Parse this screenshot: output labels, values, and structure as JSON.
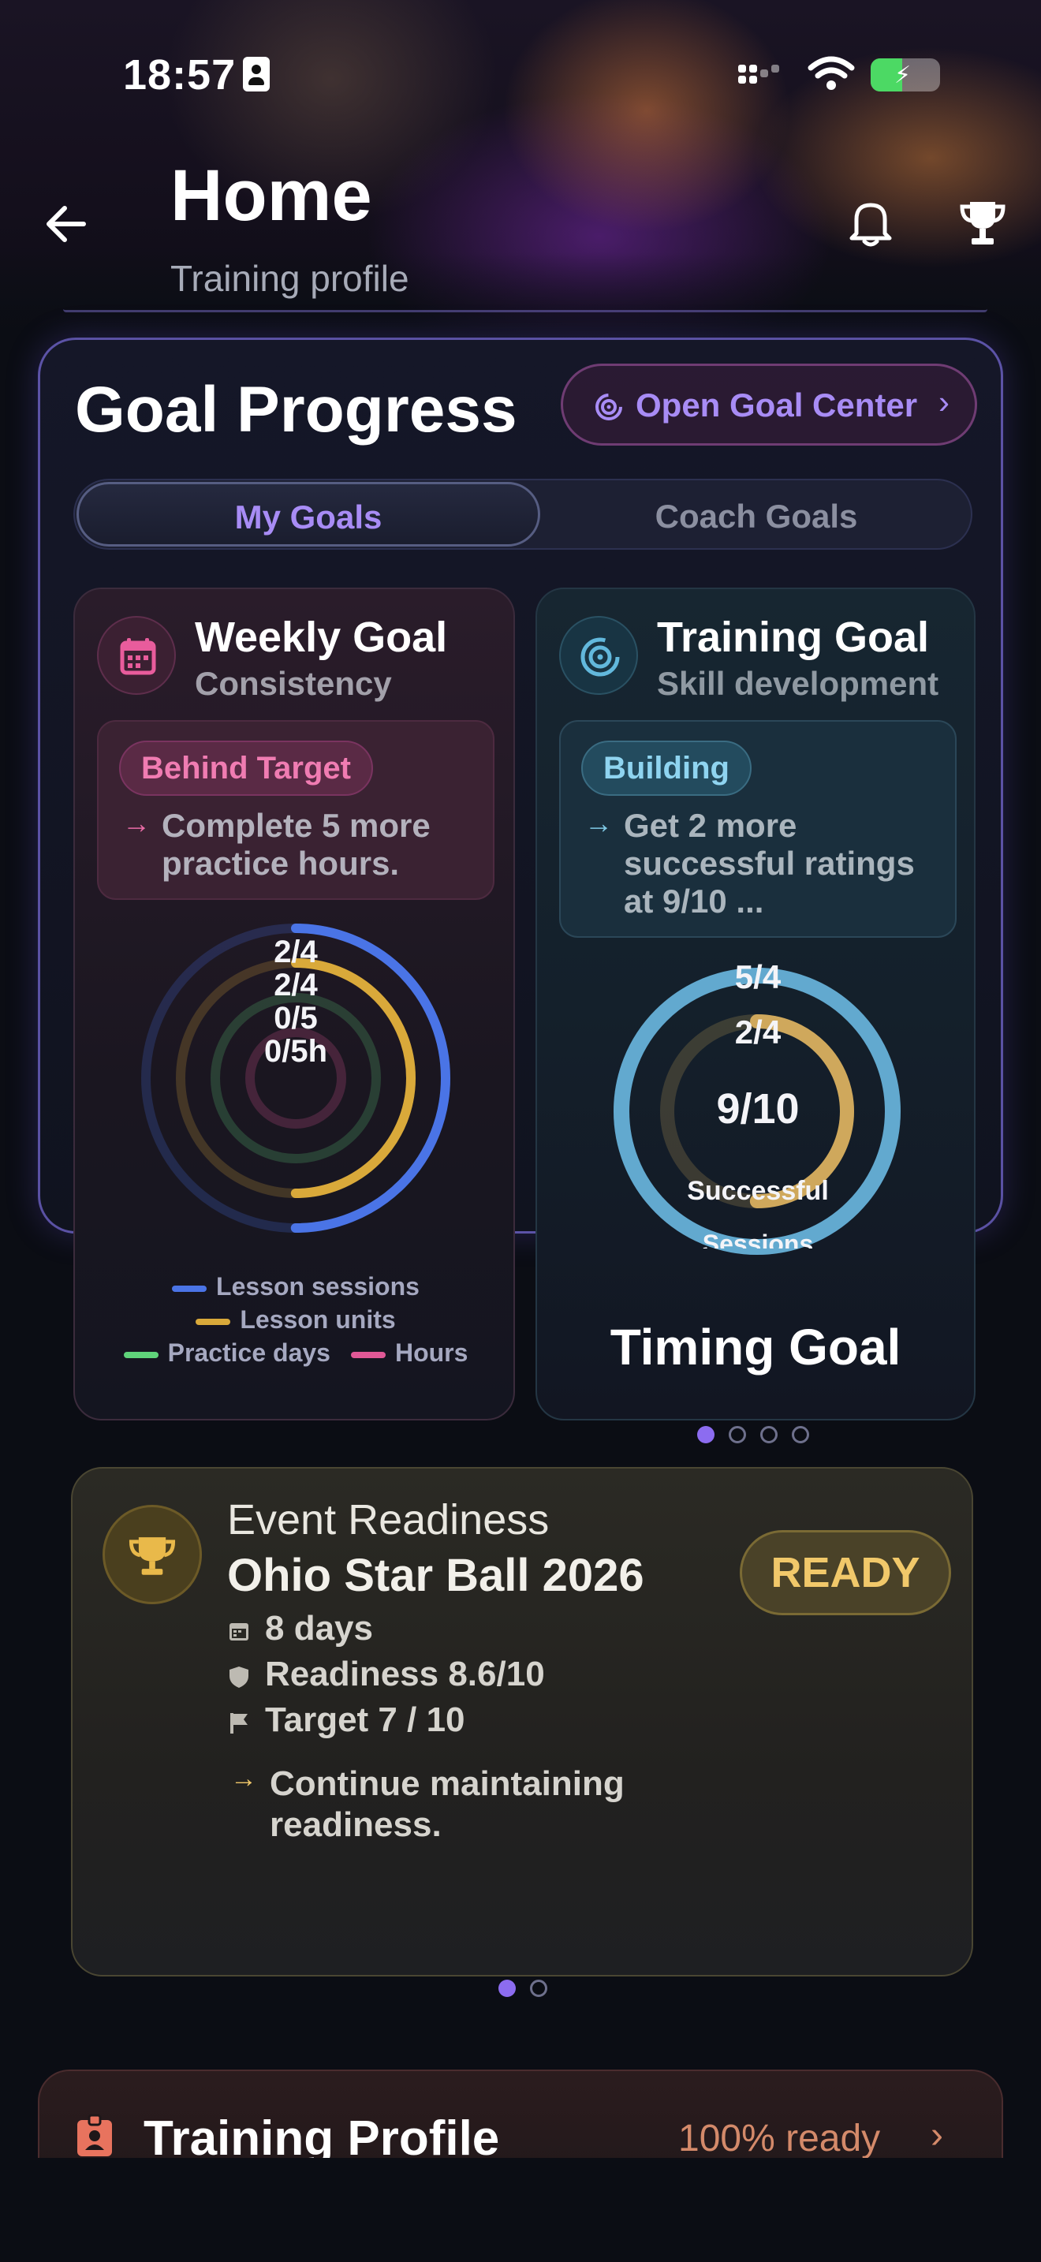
{
  "status_bar": {
    "time": "18:57"
  },
  "header": {
    "title": "Home",
    "subtitle": "Training profile"
  },
  "goal_progress": {
    "title": "Goal Progress",
    "open_button": "Open Goal Center",
    "tabs": [
      {
        "label": "My Goals",
        "selected": true
      },
      {
        "label": "Coach Goals",
        "selected": false
      }
    ],
    "weekly": {
      "title": "Weekly Goal",
      "subtitle": "Consistency",
      "status": "Behind Target",
      "message": "Complete 5 more practice hours.",
      "ring_labels": [
        "2/4",
        "2/4",
        "0/5",
        "0/5h"
      ],
      "rings": [
        {
          "name": "Lesson sessions",
          "color": "#4a74e6",
          "fraction": 0.5
        },
        {
          "name": "Lesson units",
          "color": "#d9a93a",
          "fraction": 0.5
        },
        {
          "name": "Practice days",
          "color": "#5fd37a",
          "fraction": 0
        },
        {
          "name": "Hours",
          "color": "#e05896",
          "fraction": 0
        }
      ],
      "legend": [
        "Lesson sessions",
        "Lesson units",
        "Practice days",
        "Hours"
      ]
    },
    "training": {
      "title": "Training Goal",
      "subtitle": "Skill development",
      "status": "Building",
      "message": "Get 2 more successful ratings at 9/10 ...",
      "ring_labels": [
        "5/4",
        "2/4"
      ],
      "center_value": "9/10",
      "center_caption_1": "Successful",
      "center_caption_2": "Sessions",
      "rings": [
        {
          "color": "#62a9cf",
          "fraction": 1.0
        },
        {
          "color": "#cfa85c",
          "fraction": 0.5
        }
      ],
      "next_title": "Timing Goal"
    },
    "pager_dots": 4,
    "pager_active": 0
  },
  "event": {
    "kicker": "Event Readiness",
    "name": "Ohio Star Ball 2026",
    "status": "READY",
    "days": "8 days",
    "readiness": "Readiness 8.6/10",
    "target": "Target 7 / 10",
    "message": "Continue maintaining readiness."
  },
  "outer_pager_dots": 2,
  "outer_pager_active": 0,
  "training_profile": {
    "title": "Training Profile",
    "status": "100% ready"
  },
  "colors": {
    "accent": "#a88cf5",
    "weekly_pink": "#f07cb2",
    "training_blue": "#8fd4f0",
    "event_gold": "#f1c86a"
  }
}
